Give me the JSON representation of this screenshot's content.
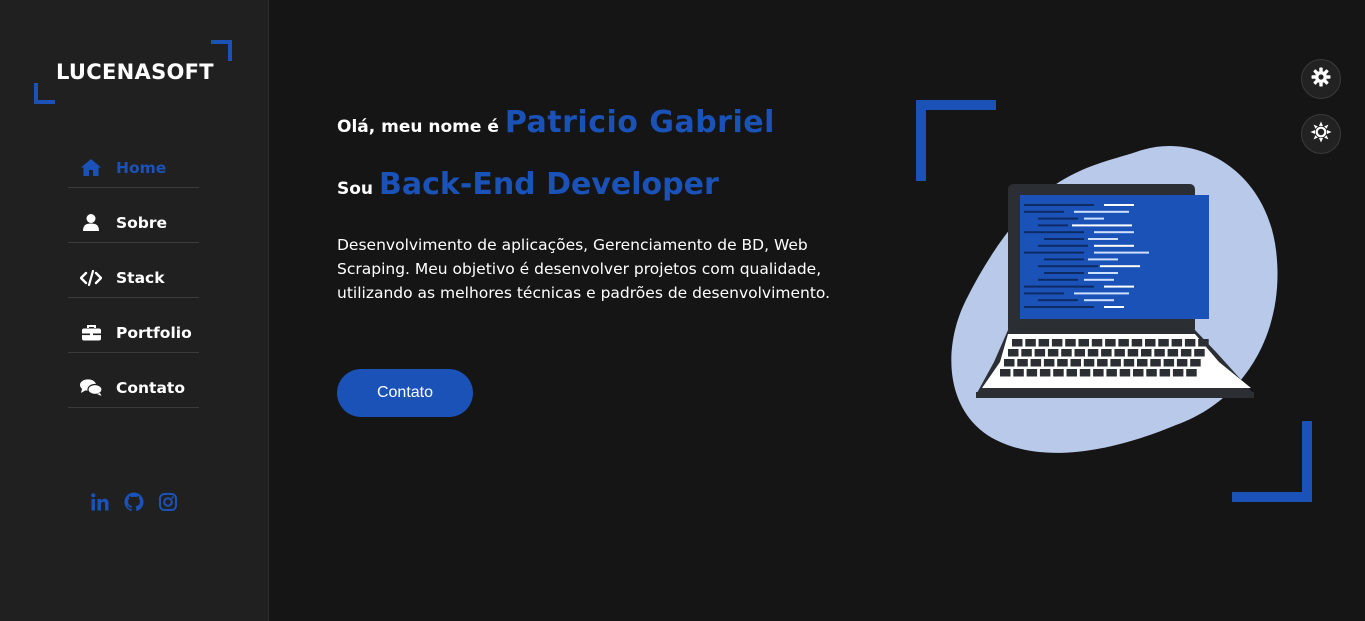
{
  "sidebar": {
    "logo": "LUCENASOFT",
    "items": [
      {
        "label": "Home",
        "icon": "home-icon"
      },
      {
        "label": "Sobre",
        "icon": "user-icon"
      },
      {
        "label": "Stack",
        "icon": "code-icon"
      },
      {
        "label": "Portfolio",
        "icon": "briefcase-icon"
      },
      {
        "label": "Contato",
        "icon": "comments-icon"
      }
    ],
    "social": [
      "linkedin-icon",
      "github-icon",
      "instagram-icon"
    ]
  },
  "hero": {
    "greeting": "Olá, meu nome é",
    "name": "Patricio Gabriel",
    "sou": "Sou",
    "role": "Back-End Developer",
    "description": "Desenvolvimento de aplicações, Gerenciamento de BD, Web Scraping. Meu objetivo é desenvolver projetos com qualidade, utilizando as melhores técnicas e padrões de desenvolvimento.",
    "cta": "Contato"
  },
  "controls": [
    "gear-icon",
    "sun-icon"
  ],
  "colors": {
    "accent": "#1b52b8",
    "background": "#151515",
    "sidebar": "#202020",
    "blob": "#b8c9ea"
  }
}
